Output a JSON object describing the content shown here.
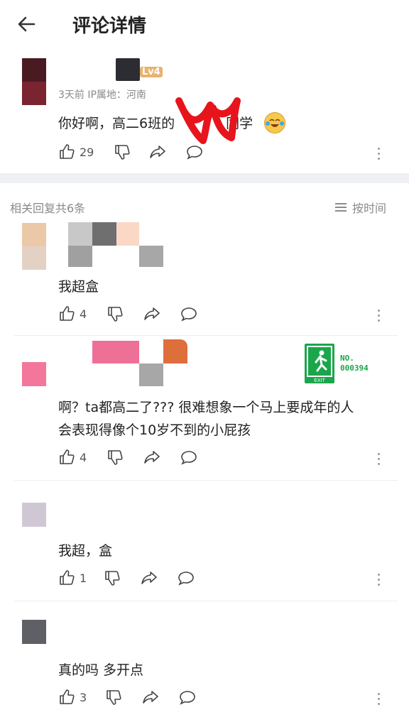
{
  "header": {
    "title": "评论详情"
  },
  "main_comment": {
    "level_badge": "Lv4",
    "meta": "3天前  IP属地：河南",
    "text_before": "你好啊，高二6班的",
    "text_after": "同学",
    "likes": "29"
  },
  "replies_header": {
    "count_label": "相关回复共6条",
    "sort_label": "按时间"
  },
  "replies": [
    {
      "text": "我超盒",
      "likes": "4"
    },
    {
      "text_line1": "啊？ta都高二了??? 很难想象一个马上要成年的人",
      "text_line2": "会表现得像个10岁不到的小屁孩",
      "likes": "4",
      "badge_no": "NO.",
      "badge_num": "000394",
      "badge_exit": "EXIT"
    },
    {
      "text": "我超，盒",
      "likes": "1"
    },
    {
      "text": "真的吗 多开点",
      "likes": "3"
    }
  ],
  "colors": {
    "exit_green": "#1aa64a",
    "scribble_red": "#e8141c",
    "separator": "#eef0f3"
  }
}
